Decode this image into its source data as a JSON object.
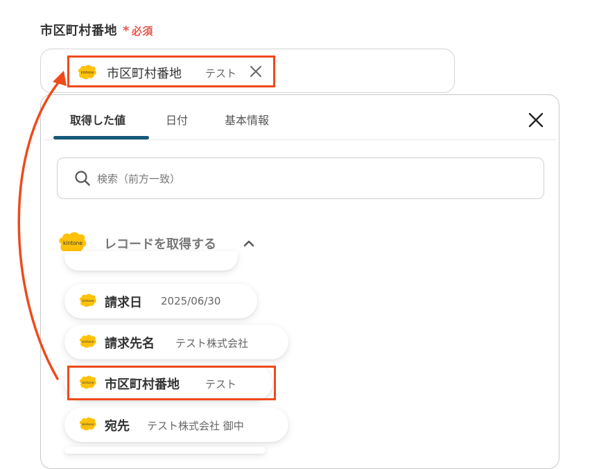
{
  "field": {
    "label": "市区町村番地",
    "required_mark": "*",
    "required_text": "必須"
  },
  "selected_chip": {
    "label": "市区町村番地",
    "value": "テスト",
    "logo_text": "kintone"
  },
  "tabs": [
    {
      "label": "取得した値",
      "active": true
    },
    {
      "label": "日付",
      "active": false
    },
    {
      "label": "基本情報",
      "active": false
    }
  ],
  "search": {
    "placeholder": "検索（前方一致）",
    "value": ""
  },
  "section": {
    "title": "レコードを取得する",
    "logo_text": "kintone"
  },
  "items": [
    {
      "label": "請求日",
      "value": "2025/06/30"
    },
    {
      "label": "請求先名",
      "value": "テスト株式会社"
    },
    {
      "label": "市区町村番地",
      "value": "テスト"
    },
    {
      "label": "宛先",
      "value": "テスト株式会社 御中"
    }
  ],
  "colors": {
    "accent_orange": "#ee4a1b",
    "tab_indicator": "#16587a",
    "kintone_yellow": "#ffc10a"
  }
}
